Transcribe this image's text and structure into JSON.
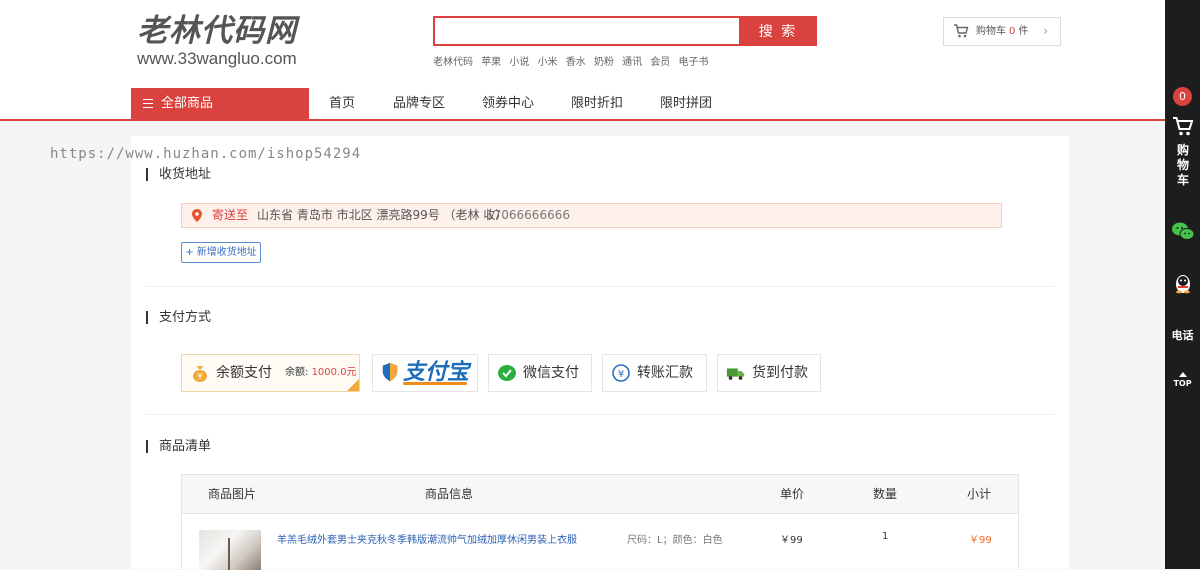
{
  "header": {
    "logo_main": "老林代码网",
    "logo_sub": "www.33wangluo.com",
    "search": {
      "placeholder": "",
      "button": "搜 索"
    },
    "hot_words": [
      "老林代码",
      "苹果",
      "小说",
      "小米",
      "香水",
      "奶粉",
      "通讯",
      "会员",
      "电子书"
    ],
    "cart": {
      "label": "购物车",
      "count": "0",
      "unit": "件",
      "arrow": "›"
    }
  },
  "nav": {
    "all_products": "全部商品",
    "items": [
      "首页",
      "品牌专区",
      "领券中心",
      "限时折扣",
      "限时拼团"
    ]
  },
  "watermark": "https://www.huzhan.com/ishop54294",
  "address": {
    "section_title": "收货地址",
    "ship_to_label": "寄送至",
    "value": "山东省 青岛市 市北区 漂亮路99号 （老林 收）",
    "phone": "17066666666",
    "add_button": "+ 新增收货地址"
  },
  "payment": {
    "section_title": "支付方式",
    "options": [
      {
        "name": "余额支付",
        "balance_label": "余额:",
        "balance": "1000.0元"
      },
      {
        "name": "支付宝"
      },
      {
        "name": "微信支付"
      },
      {
        "name": "转账汇款"
      },
      {
        "name": "货到付款"
      }
    ]
  },
  "goods": {
    "section_title": "商品清单",
    "columns": [
      "商品图片",
      "商品信息",
      "单价",
      "数量",
      "小计"
    ],
    "rows": [
      {
        "name": "羊羔毛绒外套男士夹克秋冬季韩版潮流帅气加绒加厚休闲男装上衣服",
        "spec": "尺码：L；颜色：白色",
        "price": "￥99",
        "qty": "1",
        "subtotal": "￥99"
      }
    ]
  },
  "sidebar": {
    "cart_badge": "0",
    "cart_label": "购物车",
    "phone_label": "电话",
    "top_label": "TOP"
  },
  "colors": {
    "accent": "#d9423e",
    "link": "#2b5fb4",
    "price": "#ee6a23",
    "sidebar": "#1d1d1d"
  }
}
